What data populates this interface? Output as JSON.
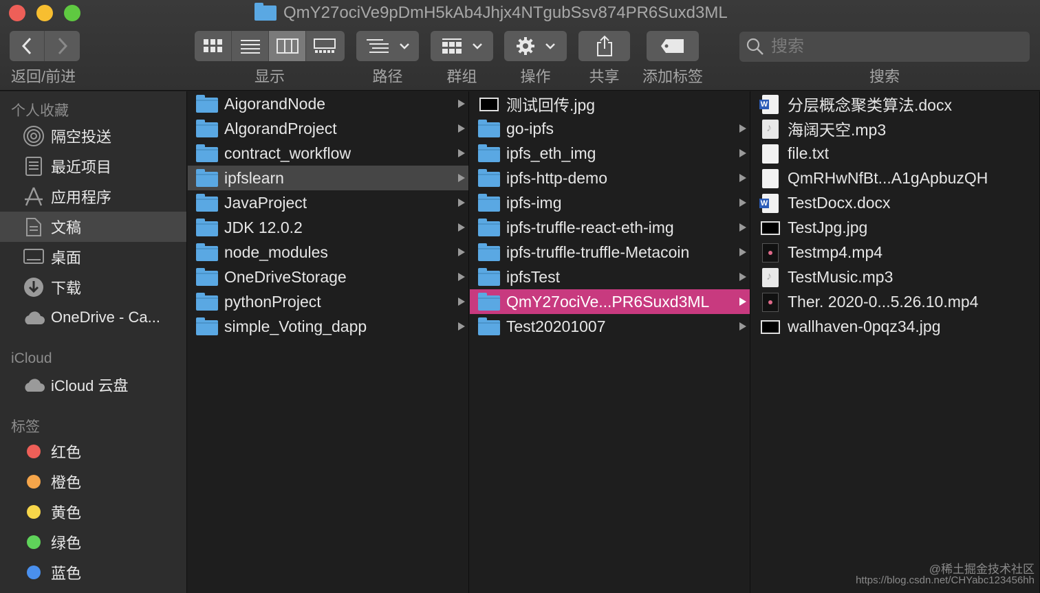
{
  "window": {
    "title": "QmY27ociVe9pDmH5kAb4Jhjx4NTgubSsv874PR6Suxd3ML"
  },
  "toolbar": {
    "nav_label": "返回/前进",
    "view_label": "显示",
    "path_label": "路径",
    "group_label": "群组",
    "action_label": "操作",
    "share_label": "共享",
    "tag_label": "添加标签",
    "search_label": "搜索",
    "search_placeholder": "搜索"
  },
  "sidebar": {
    "favorites_heading": "个人收藏",
    "favorites": [
      {
        "label": "隔空投送",
        "icon": "airdrop-icon"
      },
      {
        "label": "最近项目",
        "icon": "recents-icon"
      },
      {
        "label": "应用程序",
        "icon": "applications-icon"
      },
      {
        "label": "文稿",
        "icon": "documents-icon",
        "selected": true
      },
      {
        "label": "桌面",
        "icon": "desktop-icon"
      },
      {
        "label": "下载",
        "icon": "downloads-icon"
      },
      {
        "label": "OneDrive - Ca...",
        "icon": "cloud-icon"
      }
    ],
    "icloud_heading": "iCloud",
    "icloud": [
      {
        "label": "iCloud 云盘",
        "icon": "icloud-icon"
      }
    ],
    "tags_heading": "标签",
    "tags": [
      {
        "label": "红色",
        "color": "#ee5f58"
      },
      {
        "label": "橙色",
        "color": "#f5a54a"
      },
      {
        "label": "黄色",
        "color": "#f7d64a"
      },
      {
        "label": "绿色",
        "color": "#5fd35a"
      },
      {
        "label": "蓝色",
        "color": "#4a90ee"
      }
    ]
  },
  "columns": [
    {
      "items": [
        {
          "name": "AigorandNode",
          "type": "folder"
        },
        {
          "name": "AlgorandProject",
          "type": "folder"
        },
        {
          "name": "contract_workflow",
          "type": "folder"
        },
        {
          "name": "ipfslearn",
          "type": "folder",
          "state": "highlighted"
        },
        {
          "name": "JavaProject",
          "type": "folder"
        },
        {
          "name": "JDK 12.0.2",
          "type": "folder"
        },
        {
          "name": "node_modules",
          "type": "folder"
        },
        {
          "name": "OneDriveStorage",
          "type": "folder"
        },
        {
          "name": "pythonProject",
          "type": "folder"
        },
        {
          "name": "simple_Voting_dapp",
          "type": "folder"
        }
      ]
    },
    {
      "items": [
        {
          "name": "测试回传.jpg",
          "type": "image"
        },
        {
          "name": "go-ipfs",
          "type": "folder"
        },
        {
          "name": "ipfs_eth_img",
          "type": "folder"
        },
        {
          "name": "ipfs-http-demo",
          "type": "folder"
        },
        {
          "name": "ipfs-img",
          "type": "folder"
        },
        {
          "name": "ipfs-truffle-react-eth-img",
          "type": "folder"
        },
        {
          "name": "ipfs-truffle-truffle-Metacoin",
          "type": "folder"
        },
        {
          "name": "ipfsTest",
          "type": "folder"
        },
        {
          "name": "QmY27ociVe...PR6Suxd3ML",
          "type": "folder",
          "state": "active"
        },
        {
          "name": "Test20201007",
          "type": "folder"
        }
      ]
    },
    {
      "items": [
        {
          "name": "分层概念聚类算法.docx",
          "type": "word"
        },
        {
          "name": "海阔天空.mp3",
          "type": "audio"
        },
        {
          "name": "file.txt",
          "type": "doc"
        },
        {
          "name": "QmRHwNfBt...A1gApbuzQH",
          "type": "doc"
        },
        {
          "name": "TestDocx.docx",
          "type": "word"
        },
        {
          "name": "TestJpg.jpg",
          "type": "image"
        },
        {
          "name": "Testmp4.mp4",
          "type": "video"
        },
        {
          "name": "TestMusic.mp3",
          "type": "audio"
        },
        {
          "name": "Ther. 2020-0...5.26.10.mp4",
          "type": "video"
        },
        {
          "name": "wallhaven-0pqz34.jpg",
          "type": "image"
        }
      ]
    }
  ],
  "watermark": {
    "line1": "@稀土掘金技术社区",
    "line2": "https://blog.csdn.net/CHYabc123456hh"
  }
}
